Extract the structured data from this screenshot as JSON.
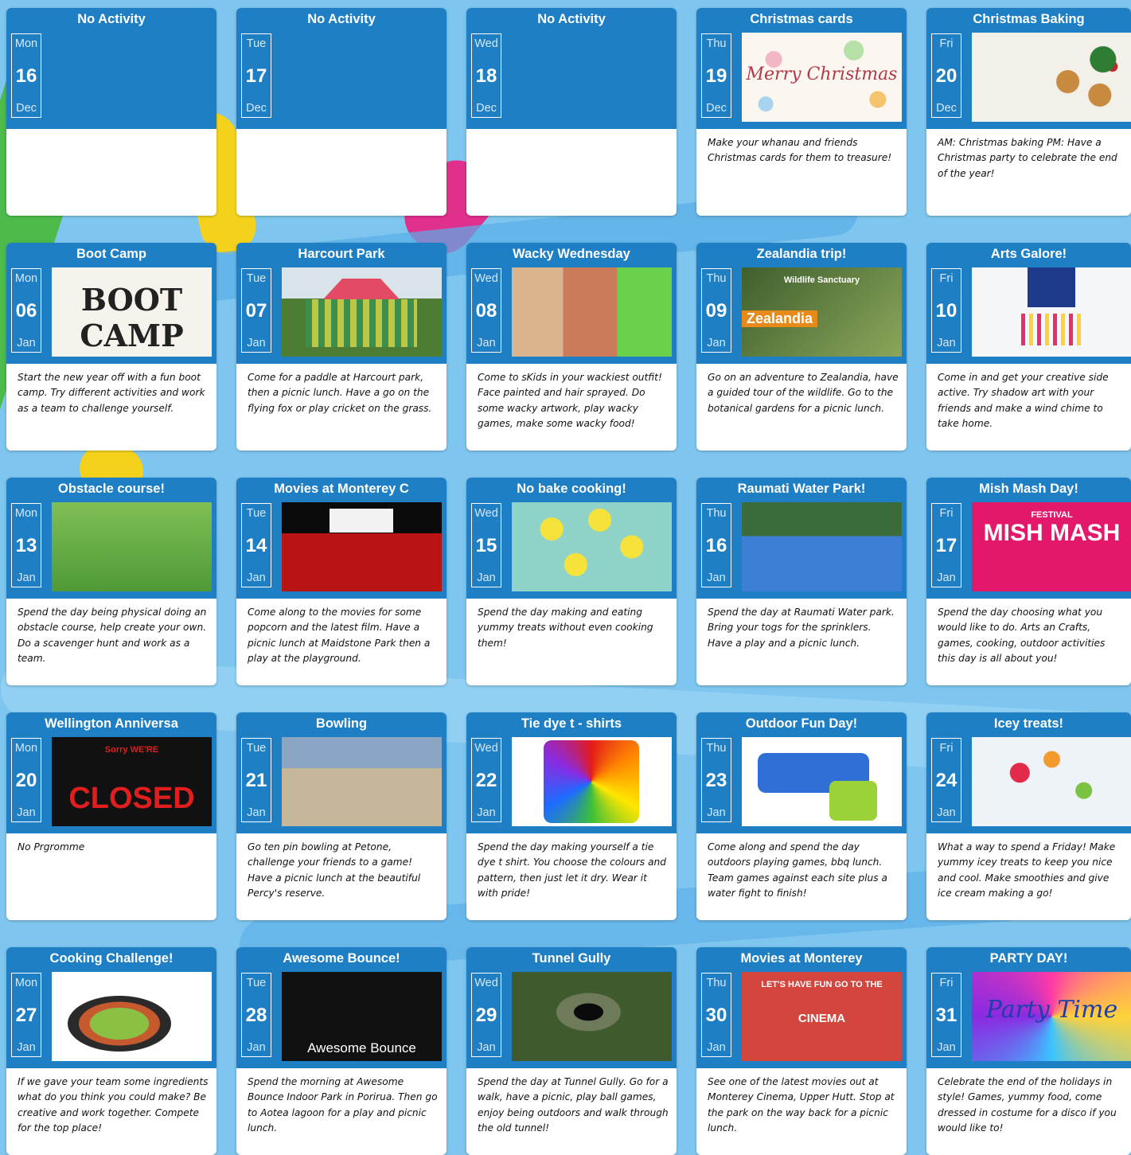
{
  "colors": {
    "header": "#1e7fc4",
    "background": "#7ec6ef",
    "card": "#ffffff"
  },
  "rows": [
    [
      {
        "title": "No Activity",
        "dow": "Mon",
        "day": "16",
        "mon": "Dec",
        "desc": "",
        "image": "",
        "has_image": false
      },
      {
        "title": "No Activity",
        "dow": "Tue",
        "day": "17",
        "mon": "Dec",
        "desc": "",
        "image": "",
        "has_image": false
      },
      {
        "title": "No Activity",
        "dow": "Wed",
        "day": "18",
        "mon": "Dec",
        "desc": "",
        "image": "",
        "has_image": false
      },
      {
        "title": "Christmas cards",
        "dow": "Thu",
        "day": "19",
        "mon": "Dec",
        "desc": "Make your whanau and friends Christmas cards for them to treasure!",
        "image": "merry-christmas-card-image",
        "has_image": true,
        "image_text": "Merry Christmas"
      },
      {
        "title": "Christmas Baking",
        "dow": "Fri",
        "day": "20",
        "mon": "Dec",
        "desc": "AM: Christmas baking PM: Have a Christmas party to celebrate the end of the year!",
        "image": "christmas-baking-image",
        "has_image": true
      }
    ],
    [
      {
        "title": "Boot Camp",
        "dow": "Mon",
        "day": "06",
        "mon": "Jan",
        "desc": "Start the new year off with a fun boot camp. Try different activities and work as a team to challenge yourself.",
        "image": "boot-camp-logo-image",
        "has_image": true,
        "image_text": "BOOT CAMP"
      },
      {
        "title": "Harcourt Park",
        "dow": "Tue",
        "day": "07",
        "mon": "Jan",
        "desc": "Come for a paddle at Harcourt park, then a picnic lunch. Have a go on the flying fox or play cricket on the grass.",
        "image": "playground-image",
        "has_image": true
      },
      {
        "title": "Wacky Wednesday",
        "dow": "Wed",
        "day": "08",
        "mon": "Jan",
        "desc": "Come to sKids in your wackiest outfit! Face painted and hair sprayed. Do some wacky artwork, play wacky games, make some wacky food!",
        "image": "wacky-hair-image",
        "has_image": true
      },
      {
        "title": "Zealandia trip!",
        "dow": "Thu",
        "day": "09",
        "mon": "Jan",
        "desc": "Go on an adventure to Zealandia, have a guided tour of the wildlife. Go to the botanical gardens for a picnic lunch.",
        "image": "zealandia-image",
        "has_image": true,
        "image_text": "Zealandia",
        "image_subtext": "Wildlife Sanctuary"
      },
      {
        "title": "Arts Galore!",
        "dow": "Fri",
        "day": "10",
        "mon": "Jan",
        "desc": "Come in and get your creative side active. Try shadow art with your friends and make a wind chime to take home.",
        "image": "wind-chime-image",
        "has_image": true
      }
    ],
    [
      {
        "title": "Obstacle course!",
        "dow": "Mon",
        "day": "13",
        "mon": "Jan",
        "desc": "Spend the day being physical doing an obstacle course, help create your own. Do a scavenger hunt and work as a team.",
        "image": "obstacle-course-image",
        "has_image": true
      },
      {
        "title": "Movies at Monterey C",
        "dow": "Tue",
        "day": "14",
        "mon": "Jan",
        "desc": "Come along to the movies for some popcorn and the latest film. Have a picnic lunch at Maidstone Park then a play at the playground.",
        "image": "cinema-seats-image",
        "has_image": true
      },
      {
        "title": "No bake cooking!",
        "dow": "Wed",
        "day": "15",
        "mon": "Jan",
        "desc": "Spend the day making and eating yummy treats without even cooking them!",
        "image": "spongebob-treats-image",
        "has_image": true
      },
      {
        "title": "Raumati Water Park!",
        "dow": "Thu",
        "day": "16",
        "mon": "Jan",
        "desc": "Spend the day at Raumati Water park. Bring your togs for the sprinklers. Have a play and a picnic lunch.",
        "image": "water-park-image",
        "has_image": true
      },
      {
        "title": "Mish Mash Day!",
        "dow": "Fri",
        "day": "17",
        "mon": "Jan",
        "desc": "Spend the day choosing what you would like to do. Arts an Crafts, games, cooking, outdoor activities this day is all about you!",
        "image": "mish-mash-logo-image",
        "has_image": true,
        "image_text": "MISH MASH",
        "image_subtext": "FESTIVAL"
      }
    ],
    [
      {
        "title": "Wellington Anniversa",
        "dow": "Mon",
        "day": "20",
        "mon": "Jan",
        "desc": "No Prgromme",
        "image": "sorry-closed-sign-image",
        "has_image": true,
        "image_text": "CLOSED",
        "image_subtext": "Sorry WE'RE"
      },
      {
        "title": "Bowling",
        "dow": "Tue",
        "day": "21",
        "mon": "Jan",
        "desc": "Go ten pin bowling at Petone, challenge your friends to a game! Have a picnic lunch at the beautiful Percy's reserve.",
        "image": "bowling-alley-image",
        "has_image": true
      },
      {
        "title": "Tie dye t - shirts",
        "dow": "Wed",
        "day": "22",
        "mon": "Jan",
        "desc": "Spend the day making yourself a tie dye t shirt. You choose the colours and pattern, then just let it dry. Wear it with pride!",
        "image": "tie-dye-shirt-image",
        "has_image": true
      },
      {
        "title": "Outdoor Fun Day!",
        "dow": "Thu",
        "day": "23",
        "mon": "Jan",
        "desc": "Come along and spend the day outdoors playing games, bbq lunch. Team games against each site plus a water fight to finish!",
        "image": "water-gun-image",
        "has_image": true
      },
      {
        "title": "Icey treats!",
        "dow": "Fri",
        "day": "24",
        "mon": "Jan",
        "desc": "What a way to spend a Friday! Make yummy icey treats to keep you nice and cool. Make smoothies and give ice cream making a go!",
        "image": "fruit-ice-pops-image",
        "has_image": true
      }
    ],
    [
      {
        "title": "Cooking Challenge!",
        "dow": "Mon",
        "day": "27",
        "mon": "Jan",
        "desc": "If we gave your team some ingredients what do you think you could make? Be creative and work together. Compete for the top place!",
        "image": "stir-fry-image",
        "has_image": true
      },
      {
        "title": "Awesome Bounce!",
        "dow": "Tue",
        "day": "28",
        "mon": "Jan",
        "desc": "Spend the morning at Awesome Bounce Indoor Park in Porirua. Then go to Aotea lagoon for a play and picnic lunch.",
        "image": "awesome-bounce-logo-image",
        "has_image": true,
        "image_text": "Awesome Bounce"
      },
      {
        "title": "Tunnel Gully",
        "dow": "Wed",
        "day": "29",
        "mon": "Jan",
        "desc": "Spend the day at Tunnel Gully. Go for a walk, have a picnic, play ball games, enjoy being outdoors and walk through the old tunnel!",
        "image": "tunnel-image",
        "has_image": true
      },
      {
        "title": "Movies at Monterey",
        "dow": "Thu",
        "day": "30",
        "mon": "Jan",
        "desc": "See one of the latest movies out at Monterey Cinema, Upper Hutt. Stop at the park on the way back for a picnic lunch.",
        "image": "cinema-sign-image",
        "has_image": true,
        "image_text": "CINEMA",
        "image_subtext": "LET'S HAVE FUN GO TO THE"
      },
      {
        "title": "PARTY DAY!",
        "dow": "Fri",
        "day": "31",
        "mon": "Jan",
        "desc": "Celebrate the end of the holidays in style! Games, yummy food, come dressed in costume for a disco if you would like to!",
        "image": "party-time-image",
        "has_image": true,
        "image_text": "Party Time"
      }
    ]
  ]
}
